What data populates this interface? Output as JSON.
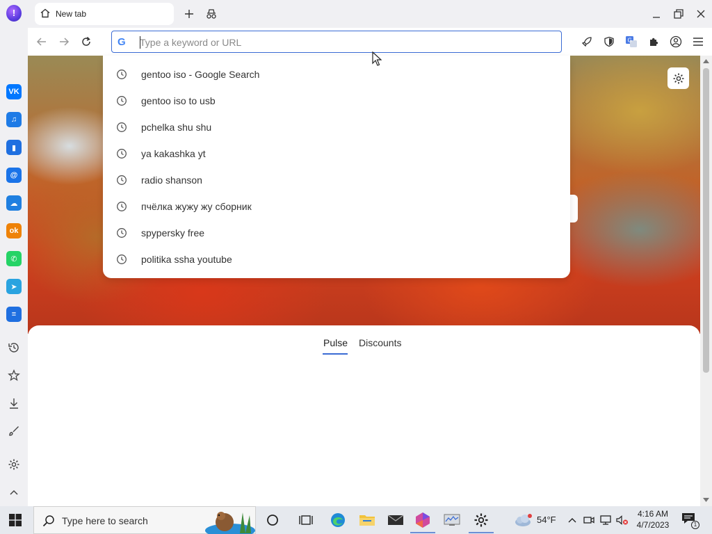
{
  "tab": {
    "title": "New tab"
  },
  "omnibox": {
    "placeholder": "Type a keyword or URL",
    "value": ""
  },
  "suggestions": [
    "gentoo iso - Google Search",
    "gentoo iso to usb",
    "pchelka shu shu",
    "ya kakashka yt",
    "radio shanson",
    "пчёлка жужу жу сборник",
    "spypersky free",
    "politika ssha youtube"
  ],
  "feed": {
    "tabs": [
      "Pulse",
      "Discounts"
    ],
    "active_tab": "Pulse"
  },
  "sidebar": {
    "apps": [
      {
        "icon": "vk-icon",
        "glyph": "VK",
        "color": "#0077ff"
      },
      {
        "icon": "music-icon",
        "glyph": "♫",
        "color": "#1e7be6"
      },
      {
        "icon": "stats-icon",
        "glyph": "▮",
        "color": "#1f6fe0"
      },
      {
        "icon": "mail-icon",
        "glyph": "@",
        "color": "#1a73e8"
      },
      {
        "icon": "cloud-icon",
        "glyph": "☁",
        "color": "#1f7fe0"
      },
      {
        "icon": "odnoklassniki-icon",
        "glyph": "ok",
        "color": "#ee8208"
      },
      {
        "icon": "whatsapp-icon",
        "glyph": "✆",
        "color": "#25d366"
      },
      {
        "icon": "telegram-icon",
        "glyph": "➤",
        "color": "#2aa3e0"
      },
      {
        "icon": "list-icon",
        "glyph": "≡",
        "color": "#1f6fe0"
      }
    ]
  },
  "taskbar": {
    "search_placeholder": "Type here to search",
    "weather": "54°F",
    "time": "4:16 AM",
    "date": "4/7/2023",
    "notifications": "1"
  }
}
